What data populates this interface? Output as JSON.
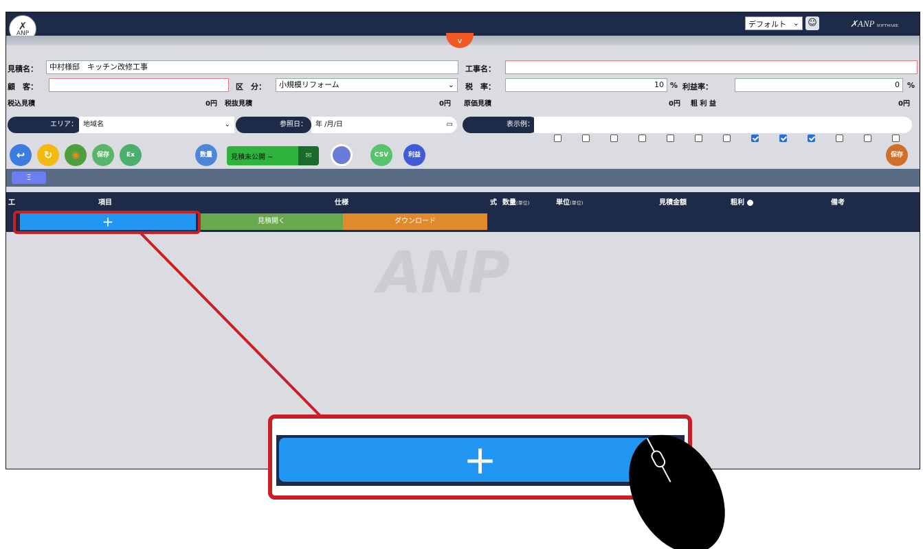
{
  "header": {
    "logo_text": "ANP",
    "toggle_glyph": "v",
    "preset_value": "デフォルト",
    "brand": "ANP",
    "brand_sub": "SOFTWARE"
  },
  "form": {
    "estimate_name_label": "見積名：",
    "estimate_name_value": "中村様邸　キッチン改修工事",
    "project_name_label": "工事名：",
    "project_name_value": "",
    "customer_label": "顧　客：",
    "customer_value": "",
    "category_label": "区　分：",
    "category_value": "小規模リフォーム",
    "tax_rate_label": "税　率：",
    "tax_rate_value": "10",
    "tax_rate_unit": "%",
    "profit_rate_label": "利益率：",
    "profit_rate_value": "0",
    "profit_rate_unit": "%",
    "tax_incl_label": "税込見積",
    "tax_incl_value": "0円",
    "tax_excl_label": "税抜見積",
    "tax_excl_value": "0円",
    "cost_label": "原価見積",
    "cost_value": "0円",
    "gross_profit_label": "粗 利 益",
    "gross_profit_value": "0円"
  },
  "filters": {
    "area_label": "エリア：",
    "area_value": "地域名",
    "ref_date_label": "参照日：",
    "ref_date_value": "年 /月/日",
    "columns_label": "表示例：",
    "columns_checked": [
      false,
      false,
      false,
      false,
      false,
      false,
      false,
      true,
      true,
      true,
      false,
      false,
      false
    ]
  },
  "toolbar": {
    "save_label": "保存",
    "excel_label": "Ex",
    "quantity_label": "数量",
    "publish_label": "見積未公開 ~",
    "csv_label": "CSV",
    "profit_label": "利益",
    "save_right_label": "保存"
  },
  "table": {
    "list_button": "Ξ",
    "headers": {
      "work": "工",
      "item": "項目",
      "spec": "仕様",
      "formula": "式",
      "qty": "数量",
      "qty_sub": "(単位)",
      "unit": "単位",
      "unit_sub": "(単位)",
      "amount": "見積金額",
      "margin": "粗利",
      "note": "備考"
    },
    "add_glyph": "+",
    "open_label": "見積開く",
    "download_label": "ダウンロード"
  },
  "watermark": "ANP",
  "zoom": {
    "add_glyph": "+"
  },
  "colors": {
    "navy": "#1d2b48",
    "add_blue": "#2196f3",
    "open_green": "#6aa84f",
    "download_orange": "#e08a2c",
    "highlight_red": "#c91f26",
    "toggle_orange": "#f05a22"
  }
}
